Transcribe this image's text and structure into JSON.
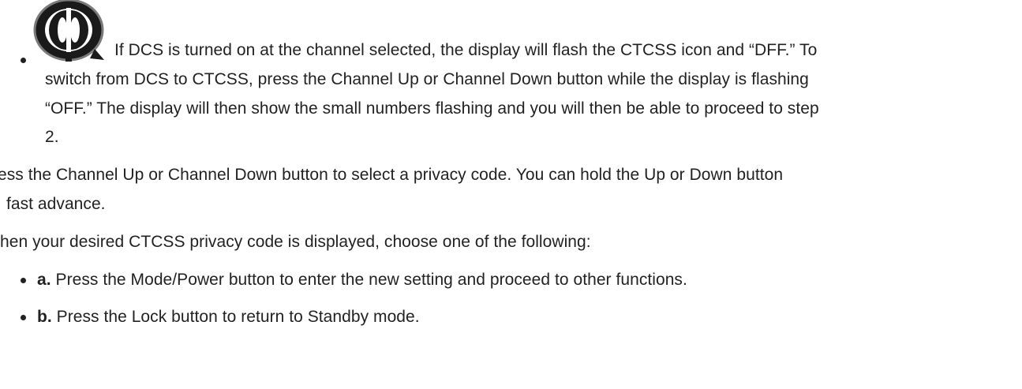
{
  "icons": {
    "privacy_icon": "dcs-ctcss-symbol-icon"
  },
  "step1_subbullet": {
    "line1": "If DCS is turned on at the channel selected, the display will flash the CTCSS icon and “DFF.” To",
    "line2": "switch from DCS to CTCSS, press the Channel Up or Channel Down button while the display is flashing",
    "line3": "“OFF.” The display will then show the small numbers flashing and you will then be able to proceed to step",
    "line4": "2."
  },
  "step2": {
    "line1": "ess the Channel Up or Channel Down button to select a privacy code. You can hold the Up or Down button",
    "line2": "fast advance."
  },
  "step3": {
    "line1": "hen your desired CTCSS privacy code is displayed, choose one of the following:",
    "options": [
      {
        "marker": "a.",
        "text": " Press the Mode/Power button to enter the new setting and proceed to other functions."
      },
      {
        "marker": "b.",
        "text": " Press the Lock button to return to Standby mode."
      }
    ]
  }
}
